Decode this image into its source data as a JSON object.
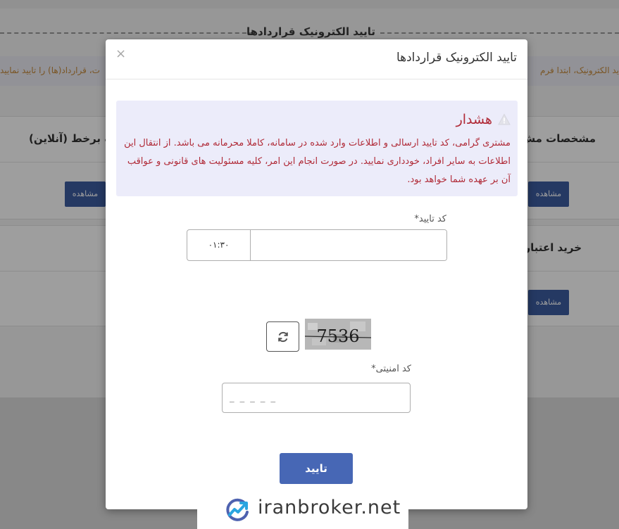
{
  "background": {
    "page_title": "تایید الکترونیک قراردادها",
    "warning_right": "ید الکترونیک، ابتدا فرم",
    "warning_left": "ت، قرارداد(ها) را تایید نمایید",
    "cards": [
      {
        "title_right": "مشخصات مش",
        "title_left": "ت برخط (آنلاین)",
        "button": "مشاهده"
      },
      {
        "title_right": "خرید اعتبار",
        "button": "مشاهده"
      }
    ]
  },
  "modal": {
    "title": "تایید الکترونیک قراردادها",
    "close_symbol": "×",
    "alert": {
      "title": "هشدار",
      "body": "مشتری گرامی، کد تایید ارسالی و اطلاعات وارد شده در سامانه، کاملا محرمانه می باشد. از انتقال این اطلاعات به سایر افراد، خودداری نمایید. در صورت انجام این امر، کلیه مسئولیت های قانونی و عواقب آن بر عهده شما خواهد بود."
    },
    "otp": {
      "label": "کد تایید*",
      "value": "",
      "timer": "۰۱:۳۰"
    },
    "captcha": {
      "text": "7536",
      "label": "کد امنیتی*",
      "placeholder": "_ _ _ _ _"
    },
    "submit_label": "تایید"
  },
  "watermark": {
    "text": "iranbroker.net"
  },
  "colors": {
    "primary_button": "#4767b5",
    "alert_bg": "#ececfa",
    "alert_text": "#b02a37",
    "bg_button": "#3c5ca0"
  }
}
